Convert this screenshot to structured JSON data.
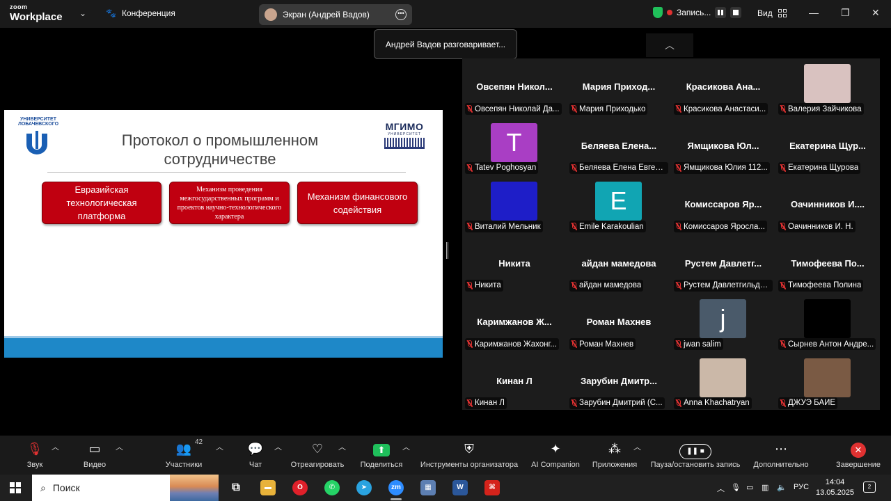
{
  "titlebar": {
    "logo_top": "zoom",
    "logo_bottom": "Workplace",
    "conference_label": "Конференция",
    "screen_label": "Экран (Андрей Вадов)",
    "recording_label": "Запись...",
    "view_label": "Вид"
  },
  "talking_tooltip": "Андрей Вадов разговаривает...",
  "slide": {
    "uni_name": "УНИВЕРСИТЕТ ЛОБАЧЕВСКОГО",
    "mgimo_name": "МГИМО",
    "mgimo_sub": "УНИВЕРСИТЕТ",
    "title_line1": "Протокол о промышленном",
    "title_line2": "сотрудничестве",
    "box1": "Евразийская технологическая платформа",
    "box2": "Механизм проведения межгосударственных программ и проектов научно-технологического характера",
    "box3": "Механизм финансового содействия"
  },
  "participants": [
    {
      "big": "Овсепян  Никол...",
      "label": "Овсепян Николай Да..."
    },
    {
      "big": "Мария  Приход...",
      "label": "Мария Приходько"
    },
    {
      "big": "Красикова  Ана...",
      "label": "Красикова Анастаси..."
    },
    {
      "big": "",
      "label": "Валерия Зайчикова",
      "photo": "#d9c2c0"
    },
    {
      "big": "",
      "label": "Tatev Poghosyan",
      "avatar": "T",
      "color": "#a93ec4"
    },
    {
      "big": "Беляева  Елена...",
      "label": "Беляева Елена Евген..."
    },
    {
      "big": "Ямщикова  Юл...",
      "label": "Ямщикова Юлия 112..."
    },
    {
      "big": "Екатерина  Щур...",
      "label": "Екатерина Щурова"
    },
    {
      "big": "",
      "label": "Виталий Мельник",
      "avatar": "",
      "color": "#1e1ec8"
    },
    {
      "big": "",
      "label": "Emile Karakoulian",
      "avatar": "E",
      "color": "#11a5b3"
    },
    {
      "big": "Комиссаров  Яр...",
      "label": "Комиссаров Яросла..."
    },
    {
      "big": "Оачинников  И....",
      "label": "Оачинников И. Н."
    },
    {
      "big": "Никита",
      "label": "Никита"
    },
    {
      "big": "айдан мамедова",
      "label": "айдан мамедова"
    },
    {
      "big": "Рустем  Давлетг...",
      "label": "Рустем Давлетгильде..."
    },
    {
      "big": "Тимофеева  По...",
      "label": "Тимофеева Полина"
    },
    {
      "big": "Каримжанов  Ж...",
      "label": "Каримжанов Жахонг..."
    },
    {
      "big": "Роман Махнев",
      "label": "Роман Махнев"
    },
    {
      "big": "",
      "label": "jwan salim",
      "avatar": "j",
      "color": "#4a5a6a"
    },
    {
      "big": "",
      "label": "Сырнев Антон Андре...",
      "avatar": "",
      "color": "#000000"
    },
    {
      "big": "Кинан Л",
      "label": "Кинан Л"
    },
    {
      "big": "Зарубин  Дмитр...",
      "label": "Зарубин Дмитрий (С..."
    },
    {
      "big": "",
      "label": "Anna Khachatryan",
      "photo": "#cbb8a8"
    },
    {
      "big": "",
      "label": "ДЖУЭ БАЙЕ",
      "photo": "#7a5a44"
    }
  ],
  "toolbar": {
    "audio": "Звук",
    "video": "Видео",
    "participants": "Участники",
    "participants_count": "42",
    "chat": "Чат",
    "react": "Отреагировать",
    "share": "Поделиться",
    "host_tools": "Инструменты организатора",
    "ai": "AI Companion",
    "apps": "Приложения",
    "pause_rec": "Пауза/остановить запись",
    "more": "Дополнительно",
    "end": "Завершение"
  },
  "taskbar": {
    "search_placeholder": "Поиск",
    "lang": "РУС",
    "time": "14:04",
    "date": "13.05.2025",
    "notif_count": "2"
  }
}
